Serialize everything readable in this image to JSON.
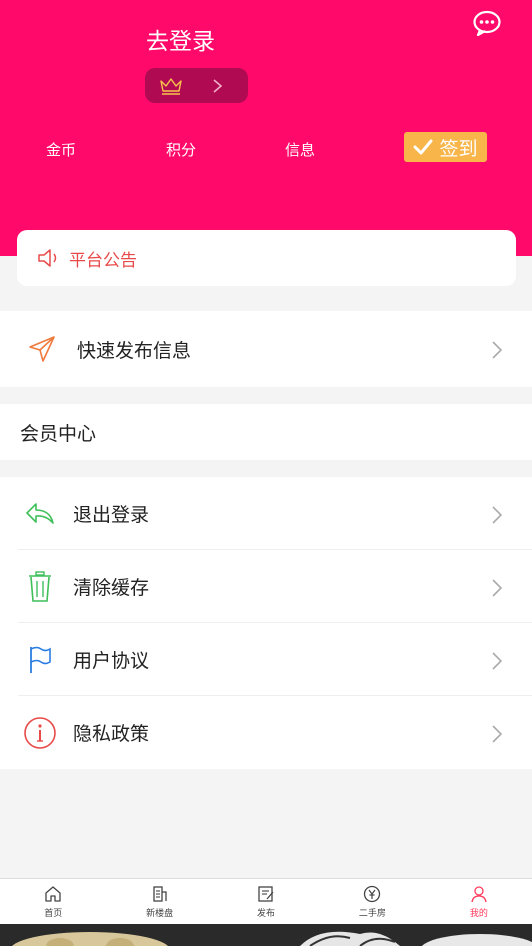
{
  "header": {
    "login_text": "去登录",
    "chat_icon": "chat-bubble-icon",
    "vip_icon": "crown-icon",
    "stats": [
      {
        "label": "金币"
      },
      {
        "label": "积分"
      },
      {
        "label": "信息"
      }
    ],
    "sign_label": "签到"
  },
  "notice": {
    "label": "平台公告",
    "icon": "speaker-icon"
  },
  "quick_publish": {
    "label": "快速发布信息",
    "icon": "send-icon"
  },
  "member_center": {
    "title": "会员中心"
  },
  "menu": [
    {
      "label": "退出登录",
      "icon": "logout-arrow-icon"
    },
    {
      "label": "清除缓存",
      "icon": "trash-icon"
    },
    {
      "label": "用户协议",
      "icon": "flag-icon"
    },
    {
      "label": "隐私政策",
      "icon": "info-icon"
    }
  ],
  "tabbar": [
    {
      "label": "首页",
      "icon": "home-icon"
    },
    {
      "label": "新楼盘",
      "icon": "building-icon"
    },
    {
      "label": "发布",
      "icon": "edit-icon"
    },
    {
      "label": "二手房",
      "icon": "yen-icon"
    },
    {
      "label": "我的",
      "icon": "user-icon",
      "active": true
    }
  ],
  "colors": {
    "brand": "#ff0a6a",
    "accent_sign": "#f8b54a",
    "notice": "#e84a4a",
    "tab_active": "#ff3b5c"
  }
}
